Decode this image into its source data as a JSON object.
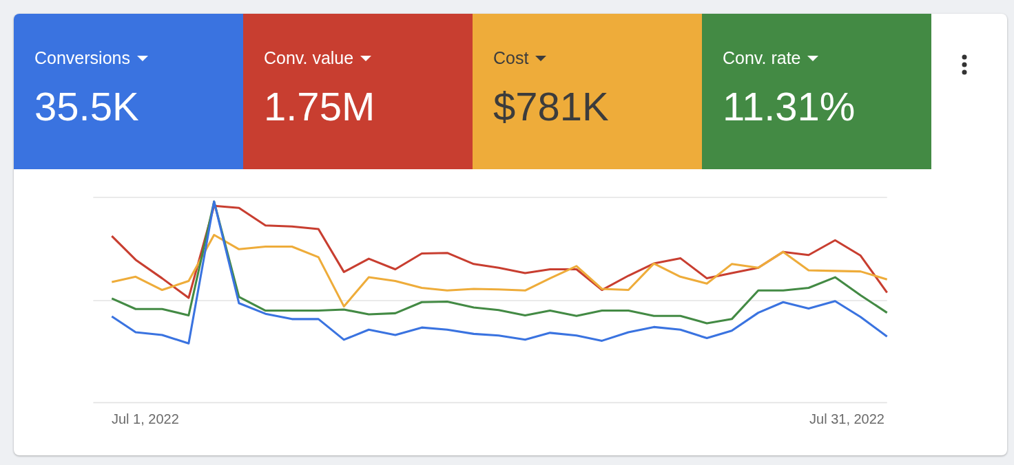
{
  "metrics": [
    {
      "label": "Conversions",
      "value": "35.5K",
      "color": "#3a73e0"
    },
    {
      "label": "Conv. value",
      "value": "1.75M",
      "color": "#c83e30"
    },
    {
      "label": "Cost",
      "value": "$781K",
      "color": "#eeac3a"
    },
    {
      "label": "Conv. rate",
      "value": "11.31%",
      "color": "#438a44"
    }
  ],
  "chart": {
    "x_labels": [
      "Jul 1, 2022",
      "Jul 31, 2022"
    ]
  }
}
